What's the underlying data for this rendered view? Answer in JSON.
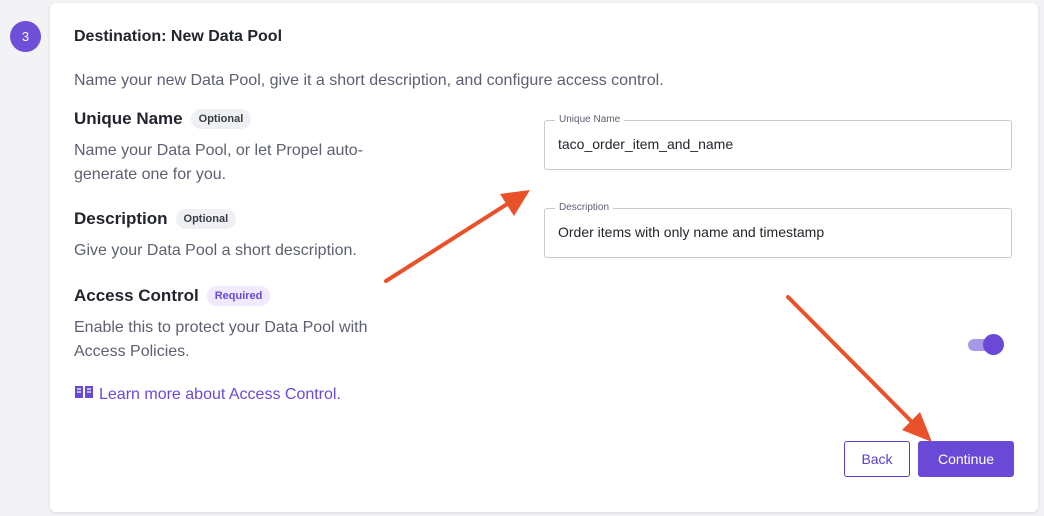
{
  "step": {
    "number": "3"
  },
  "card": {
    "title": "Destination: New Data Pool",
    "intro": "Name your new Data Pool, give it a short description, and configure access control."
  },
  "sections": {
    "unique_name": {
      "title": "Unique Name",
      "tag": "Optional",
      "description": "Name your Data Pool, or let Propel auto-generate one for you."
    },
    "description": {
      "title": "Description",
      "tag": "Optional",
      "description": "Give your Data Pool a short description."
    },
    "access_control": {
      "title": "Access Control",
      "tag": "Required",
      "description": "Enable this to protect your Data Pool with Access Policies."
    }
  },
  "learn_more": {
    "label": "Learn more about Access Control.",
    "icon": "book-icon"
  },
  "fields": {
    "unique_name": {
      "label": "Unique Name",
      "value": "taco_order_item_and_name"
    },
    "description": {
      "label": "Description",
      "value": "Order items with only name and timestamp"
    }
  },
  "toggle": {
    "access_control_enabled": true
  },
  "buttons": {
    "back": "Back",
    "continue": "Continue"
  },
  "colors": {
    "accent": "#6a49d6",
    "annotation_arrow": "#e8512a",
    "background": "#f3f3f5"
  }
}
